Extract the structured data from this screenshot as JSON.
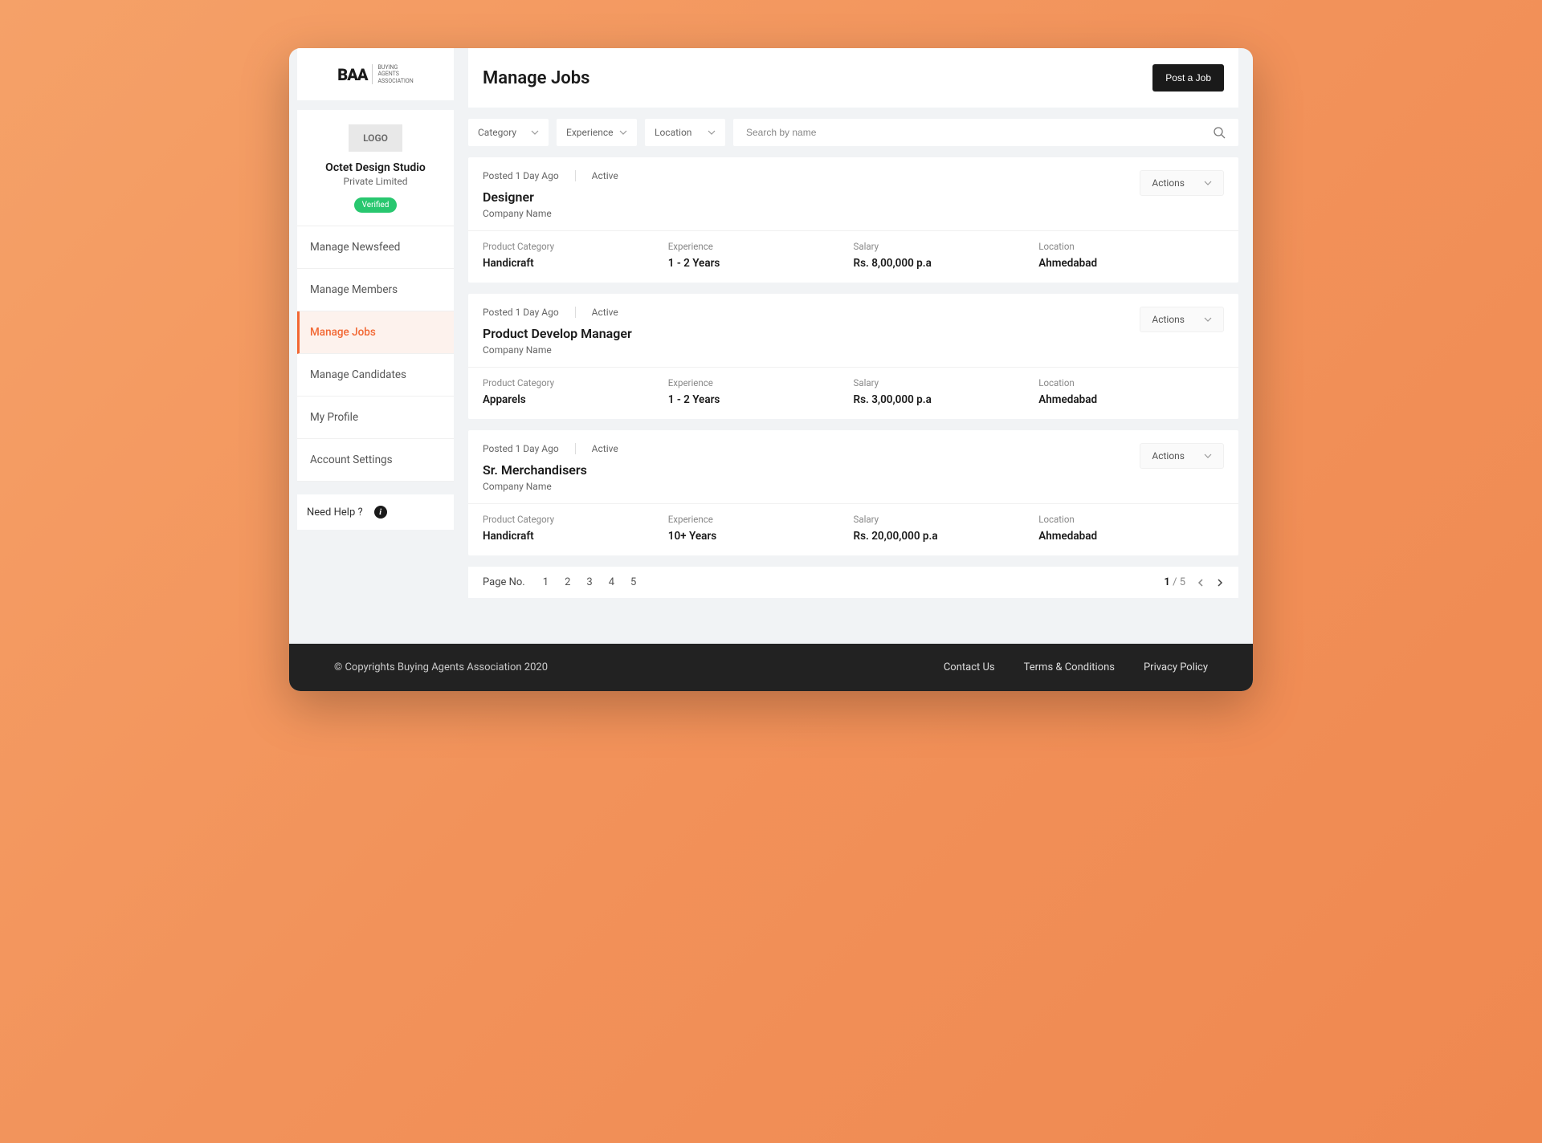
{
  "brand": {
    "mark": "BAA",
    "line1": "BUYING",
    "line2": "AGENTS",
    "line3": "ASSOCIATION"
  },
  "company": {
    "logo_placeholder": "LOGO",
    "name": "Octet Design Studio",
    "sub": "Private Limited",
    "badge": "Verified"
  },
  "nav": {
    "items": [
      "Manage Newsfeed",
      "Manage Members",
      "Manage Jobs",
      "Manage Candidates",
      "My Profile",
      "Account Settings"
    ],
    "active_index": 2
  },
  "help": {
    "label": "Need Help ?"
  },
  "header": {
    "title": "Manage Jobs",
    "post_label": "Post a Job"
  },
  "filters": {
    "category": "Category",
    "experience": "Experience",
    "location": "Location",
    "search_placeholder": "Search by name"
  },
  "labels": {
    "product_category": "Product Category",
    "experience": "Experience",
    "salary": "Salary",
    "location": "Location",
    "actions": "Actions",
    "page_no": "Page No."
  },
  "jobs": [
    {
      "posted": "Posted 1 Day Ago",
      "status": "Active",
      "title": "Designer",
      "company": "Company Name",
      "product_category": "Handicraft",
      "experience": "1 - 2 Years",
      "salary": "Rs. 8,00,000 p.a",
      "location": "Ahmedabad"
    },
    {
      "posted": "Posted 1 Day Ago",
      "status": "Active",
      "title": "Product Develop Manager",
      "company": "Company Name",
      "product_category": "Apparels",
      "experience": "1 - 2 Years",
      "salary": "Rs. 3,00,000 p.a",
      "location": "Ahmedabad"
    },
    {
      "posted": "Posted 1 Day Ago",
      "status": "Active",
      "title": "Sr. Merchandisers",
      "company": "Company Name",
      "product_category": "Handicraft",
      "experience": "10+ Years",
      "salary": "Rs. 20,00,000 p.a",
      "location": "Ahmedabad"
    }
  ],
  "pagination": {
    "pages": [
      "1",
      "2",
      "3",
      "4",
      "5"
    ],
    "current": "1",
    "total": "5"
  },
  "footer": {
    "copyright": "© Copyrights Buying Agents Association 2020",
    "links": [
      "Contact Us",
      "Terms & Conditions",
      "Privacy Policy"
    ]
  }
}
